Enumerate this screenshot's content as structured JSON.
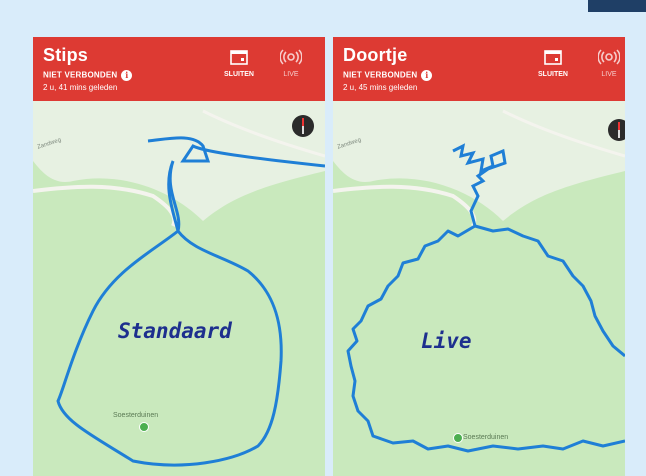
{
  "panels": [
    {
      "title": "Stips",
      "status": "NIET VERBONDEN",
      "time": "2 u, 41 mins geleden",
      "close_label": "SLUITEN",
      "live_label": "LIVE",
      "map_label": "Standaard",
      "place_label": "Soesterduinen",
      "road_label": "Zandweg"
    },
    {
      "title": "Doortje",
      "status": "NIET VERBONDEN",
      "time": "2 u, 45 mins geleden",
      "close_label": "SLUITEN",
      "live_label": "LIVE",
      "map_label": "Live",
      "place_label": "Soesterduinen",
      "road_label": "Zandweg"
    }
  ],
  "colors": {
    "header": "#dd3a33",
    "track": "#1f7fd6",
    "map_green": "#c9e9bd",
    "map_light": "#e7f1e2",
    "label": "#1d2f8e"
  },
  "icons": [
    "calendar-icon",
    "live-broadcast-icon",
    "info-icon",
    "compass-icon",
    "place-pin-icon"
  ]
}
